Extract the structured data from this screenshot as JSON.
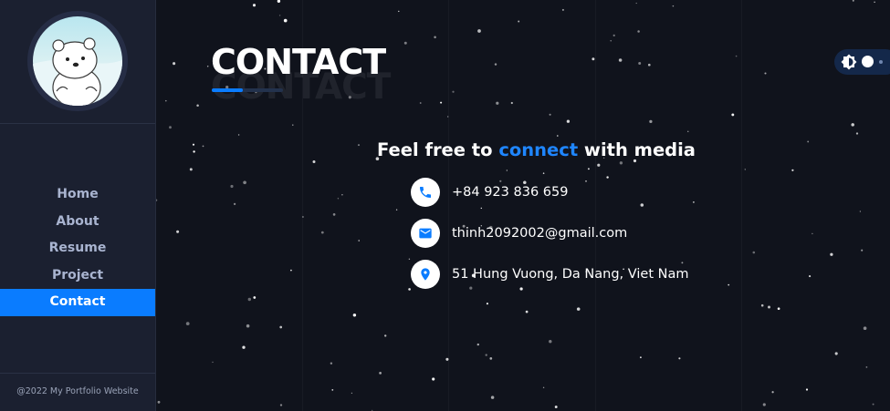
{
  "sidebar": {
    "avatar_alt": "bear",
    "nav": [
      {
        "label": "Home",
        "active": false
      },
      {
        "label": "About",
        "active": false
      },
      {
        "label": "Resume",
        "active": false
      },
      {
        "label": "Project",
        "active": false
      },
      {
        "label": "Contact",
        "active": true
      }
    ],
    "footer": "@2022 My Portfolio Website"
  },
  "main": {
    "title": "CONTACT",
    "title_shadow": "CONTACT",
    "headline": {
      "before": "Feel free to ",
      "accent": "connect",
      "after": " with media"
    },
    "contacts": [
      {
        "icon": "phone-icon",
        "text": "+84 923 836 659"
      },
      {
        "icon": "mail-icon",
        "text": "thinh2092002@gmail.com"
      },
      {
        "icon": "location-icon",
        "text": "51 Hung Vuong, Da Nang, Viet Nam"
      }
    ]
  },
  "theme_toggle": {
    "icon": "brightness-icon",
    "state": "dark"
  },
  "colors": {
    "accent": "#0a7cff",
    "background": "#10131c",
    "sidebar": "#1b2030",
    "text": "#ffffff",
    "nav_text": "#a9b4d0"
  }
}
